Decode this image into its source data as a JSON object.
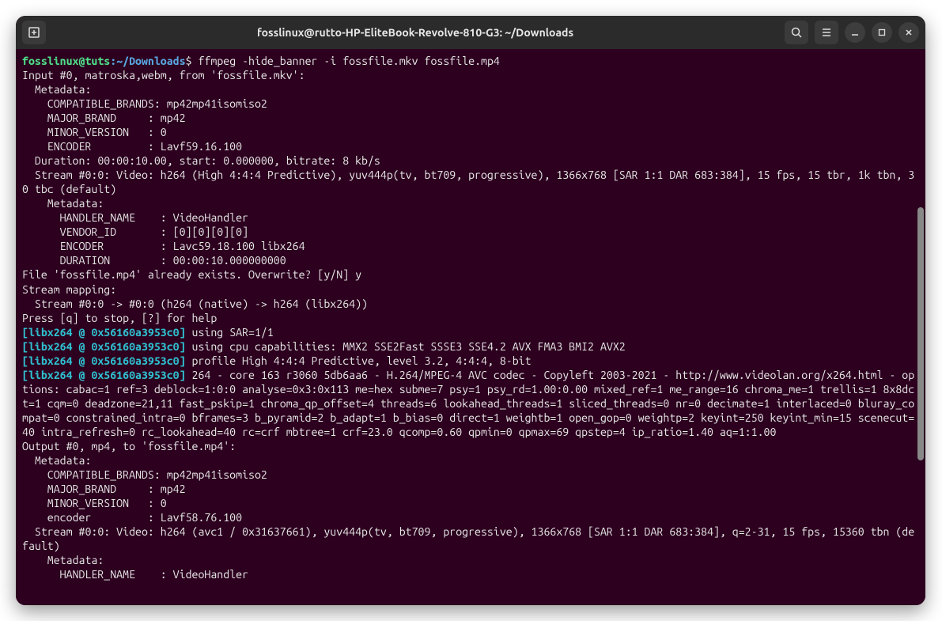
{
  "titlebar": {
    "title": "fosslinux@rutto-HP-EliteBook-Revolve-810-G3: ~/Downloads"
  },
  "prompt": {
    "userhost": "fosslinux@tuts",
    "colon": ":",
    "path": "~/Downloads",
    "dollar": "$",
    "command": "ffmpeg -hide_banner -i fossfile.mkv fossfile.mp4"
  },
  "lines": {
    "l1": "Input #0, matroska,webm, from 'fossfile.mkv':",
    "l2": "  Metadata:",
    "l3": "    COMPATIBLE_BRANDS: mp42mp41isomiso2",
    "l4": "    MAJOR_BRAND     : mp42",
    "l5": "    MINOR_VERSION   : 0",
    "l6": "    ENCODER         : Lavf59.16.100",
    "l7": "  Duration: 00:00:10.00, start: 0.000000, bitrate: 8 kb/s",
    "l8": "  Stream #0:0: Video: h264 (High 4:4:4 Predictive), yuv444p(tv, bt709, progressive), 1366x768 [SAR 1:1 DAR 683:384], 15 fps, 15 tbr, 1k tbn, 30 tbc (default)",
    "l9": "    Metadata:",
    "l10": "      HANDLER_NAME    : VideoHandler",
    "l11": "      VENDOR_ID       : [0][0][0][0]",
    "l12": "      ENCODER         : Lavc59.18.100 libx264",
    "l13": "      DURATION        : 00:00:10.000000000",
    "l14": "File 'fossfile.mp4' already exists. Overwrite? [y/N] y",
    "l15": "Stream mapping:",
    "l16": "  Stream #0:0 -> #0:0 (h264 (native) -> h264 (libx264))",
    "l17": "Press [q] to stop, [?] for help",
    "libtag": "[libx264 @ 0x56160a3953c0]",
    "l18": " using SAR=1/1",
    "l19": " using cpu capabilities: MMX2 SSE2Fast SSSE3 SSE4.2 AVX FMA3 BMI2 AVX2",
    "l20": " profile High 4:4:4 Predictive, level 3.2, 4:4:4, 8-bit",
    "l21": " 264 - core 163 r3060 5db6aa6 - H.264/MPEG-4 AVC codec - Copyleft 2003-2021 - http://www.videolan.org/x264.html - options: cabac=1 ref=3 deblock=1:0:0 analyse=0x3:0x113 me=hex subme=7 psy=1 psy_rd=1.00:0.00 mixed_ref=1 me_range=16 chroma_me=1 trellis=1 8x8dct=1 cqm=0 deadzone=21,11 fast_pskip=1 chroma_qp_offset=4 threads=6 lookahead_threads=1 sliced_threads=0 nr=0 decimate=1 interlaced=0 bluray_compat=0 constrained_intra=0 bframes=3 b_pyramid=2 b_adapt=1 b_bias=0 direct=1 weightb=1 open_gop=0 weightp=2 keyint=250 keyint_min=15 scenecut=40 intra_refresh=0 rc_lookahead=40 rc=crf mbtree=1 crf=23.0 qcomp=0.60 qpmin=0 qpmax=69 qpstep=4 ip_ratio=1.40 aq=1:1.00",
    "l22": "Output #0, mp4, to 'fossfile.mp4':",
    "l23": "  Metadata:",
    "l24": "    COMPATIBLE_BRANDS: mp42mp41isomiso2",
    "l25": "    MAJOR_BRAND     : mp42",
    "l26": "    MINOR_VERSION   : 0",
    "l27": "    encoder         : Lavf58.76.100",
    "l28": "  Stream #0:0: Video: h264 (avc1 / 0x31637661), yuv444p(tv, bt709, progressive), 1366x768 [SAR 1:1 DAR 683:384], q=2-31, 15 fps, 15360 tbn (default)",
    "l29": "    Metadata:",
    "l30": "      HANDLER_NAME    : VideoHandler"
  }
}
